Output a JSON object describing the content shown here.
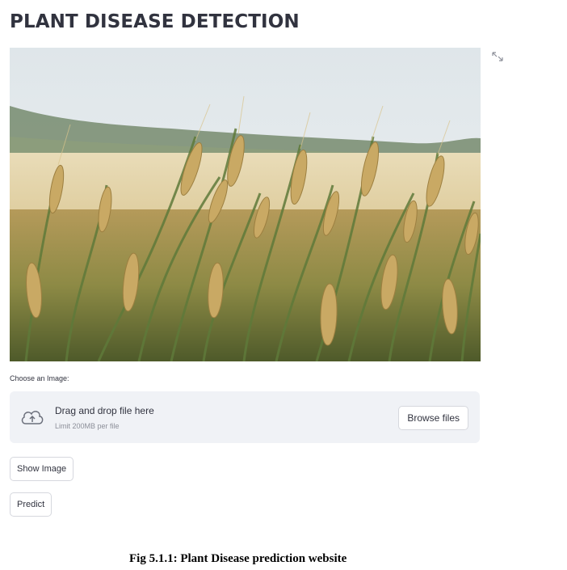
{
  "page": {
    "title": "PLANT DISEASE DETECTION"
  },
  "hero_image": {
    "description_icon": "wheat-field-photo"
  },
  "uploader": {
    "label": "Choose an Image:",
    "drop_text": "Drag and drop file here",
    "limit_text": "Limit 200MB per file",
    "browse_label": "Browse files"
  },
  "buttons": {
    "show_image": "Show Image",
    "predict": "Predict"
  },
  "caption": {
    "text": "Fig 5.1.1: Plant Disease prediction website"
  },
  "colors": {
    "text": "#31333f",
    "dropzone_bg": "#f0f2f6",
    "button_border": "#d6d8de"
  }
}
